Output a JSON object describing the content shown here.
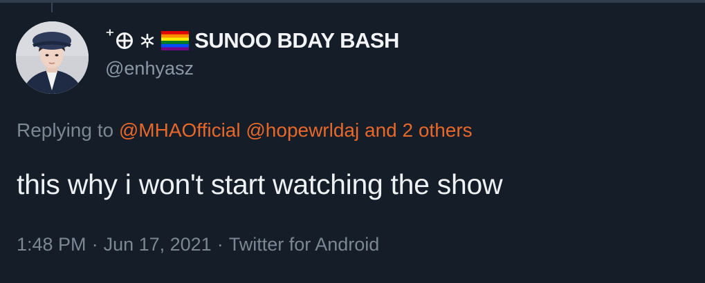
{
  "tweet": {
    "display_name": "SUNOO BDAY BASH",
    "name_prefix_glyph": "⁺",
    "name_emojis": [
      "circled-cross-icon",
      "snowflake-icon",
      "rainbow-flag-icon"
    ],
    "handle": "@enhyasz",
    "replying_to_label": "Replying to",
    "replying_to_mentions": [
      "@MHAOfficial",
      "@hopewrldaj"
    ],
    "replying_to_and": "and",
    "replying_to_others": "2 others",
    "text": "this why i won't start watching the show",
    "time": "1:48 PM",
    "date": "Jun 17, 2021",
    "source": "Twitter for Android",
    "separator": "·"
  },
  "colors": {
    "background": "#151d28",
    "mention": "#e8682a",
    "secondary_text": "#7b8894",
    "primary_text": "#eef1f3"
  }
}
